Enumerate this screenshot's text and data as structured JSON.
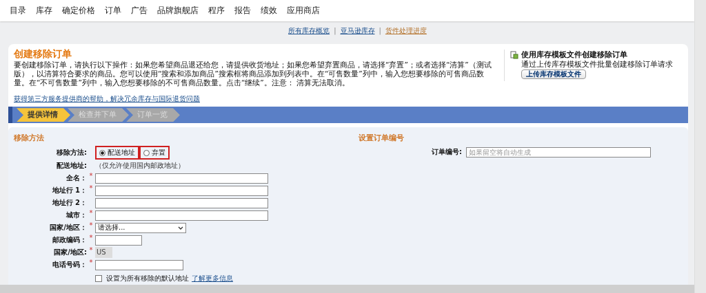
{
  "nav": {
    "items": [
      {
        "label": "目录"
      },
      {
        "label": "库存"
      },
      {
        "label": "确定价格"
      },
      {
        "label": "订单"
      },
      {
        "label": "广告"
      },
      {
        "label": "品牌旗舰店"
      },
      {
        "label": "程序"
      },
      {
        "label": "报告"
      },
      {
        "label": "绩效"
      },
      {
        "label": "应用商店"
      }
    ]
  },
  "subnav": {
    "links": [
      {
        "label": "所有库存概览",
        "selected": false
      },
      {
        "label": "亚马逊库存",
        "selected": false
      },
      {
        "label": "货件处理进度",
        "selected": true
      }
    ],
    "separator": "|"
  },
  "card": {
    "title": "创建移除订单",
    "description": "要创建移除订单，请执行以下操作：如果您希望商品退还给您，请提供收货地址；如果您希望弃置商品，请选择“弃置”；或者选择“清算”（测试版），以清算符合要求的商品。您可以使用“搜索和添加商品”搜索框将商品添加到列表中。在“可售数量”列中，输入您想要移除的可售商品数量。在“不可售数量”列中，输入您想要移除的不可售商品数量。点击“继续”。注意： 清算无法取消。",
    "help_link": "获得第三方服务提供商的帮助，解决冗余库存与国际退货问题",
    "upload": {
      "title": "使用库存模板文件创建移除订单",
      "text": "通过上传库存模板文件批量创建移除订单请求",
      "button": "上传库存模板文件"
    }
  },
  "steps": [
    {
      "label": "提供详情",
      "selected": true
    },
    {
      "label": "检查并下单",
      "selected": false
    },
    {
      "label": "订单一览",
      "selected": false
    }
  ],
  "removal": {
    "heading": "移除方法",
    "method_label": "移除方法:",
    "options": [
      {
        "label": "配送地址",
        "selected": true,
        "highlighted": true
      },
      {
        "label": "弃置",
        "selected": false,
        "highlighted": true
      }
    ],
    "address_label": "配送地址:",
    "address_note": "（仅允许使用国内邮政地址）",
    "required_mark": "*",
    "fields": [
      {
        "label": "全名：",
        "required": true,
        "kind": "text"
      },
      {
        "label": "地址行 1：",
        "required": true,
        "kind": "text"
      },
      {
        "label": "地址行 2：",
        "required": false,
        "kind": "text"
      },
      {
        "label": "城市：",
        "required": true,
        "kind": "text"
      },
      {
        "label": "国家/地区：",
        "required": true,
        "kind": "select",
        "value": "请选择..."
      },
      {
        "label": "邮政编码：",
        "required": true,
        "kind": "postal"
      },
      {
        "label": "国家/地区:",
        "required": true,
        "kind": "readonly",
        "value": "US"
      },
      {
        "label": "电话号码：",
        "required": true,
        "kind": "phone"
      }
    ],
    "default": {
      "label": "设置为所有移除的默认地址",
      "checked": false,
      "link": "了解更多信息"
    }
  },
  "order": {
    "heading": "设置订单编号",
    "label": "订单编号:",
    "placeholder": "如果留空将自动生成"
  }
}
